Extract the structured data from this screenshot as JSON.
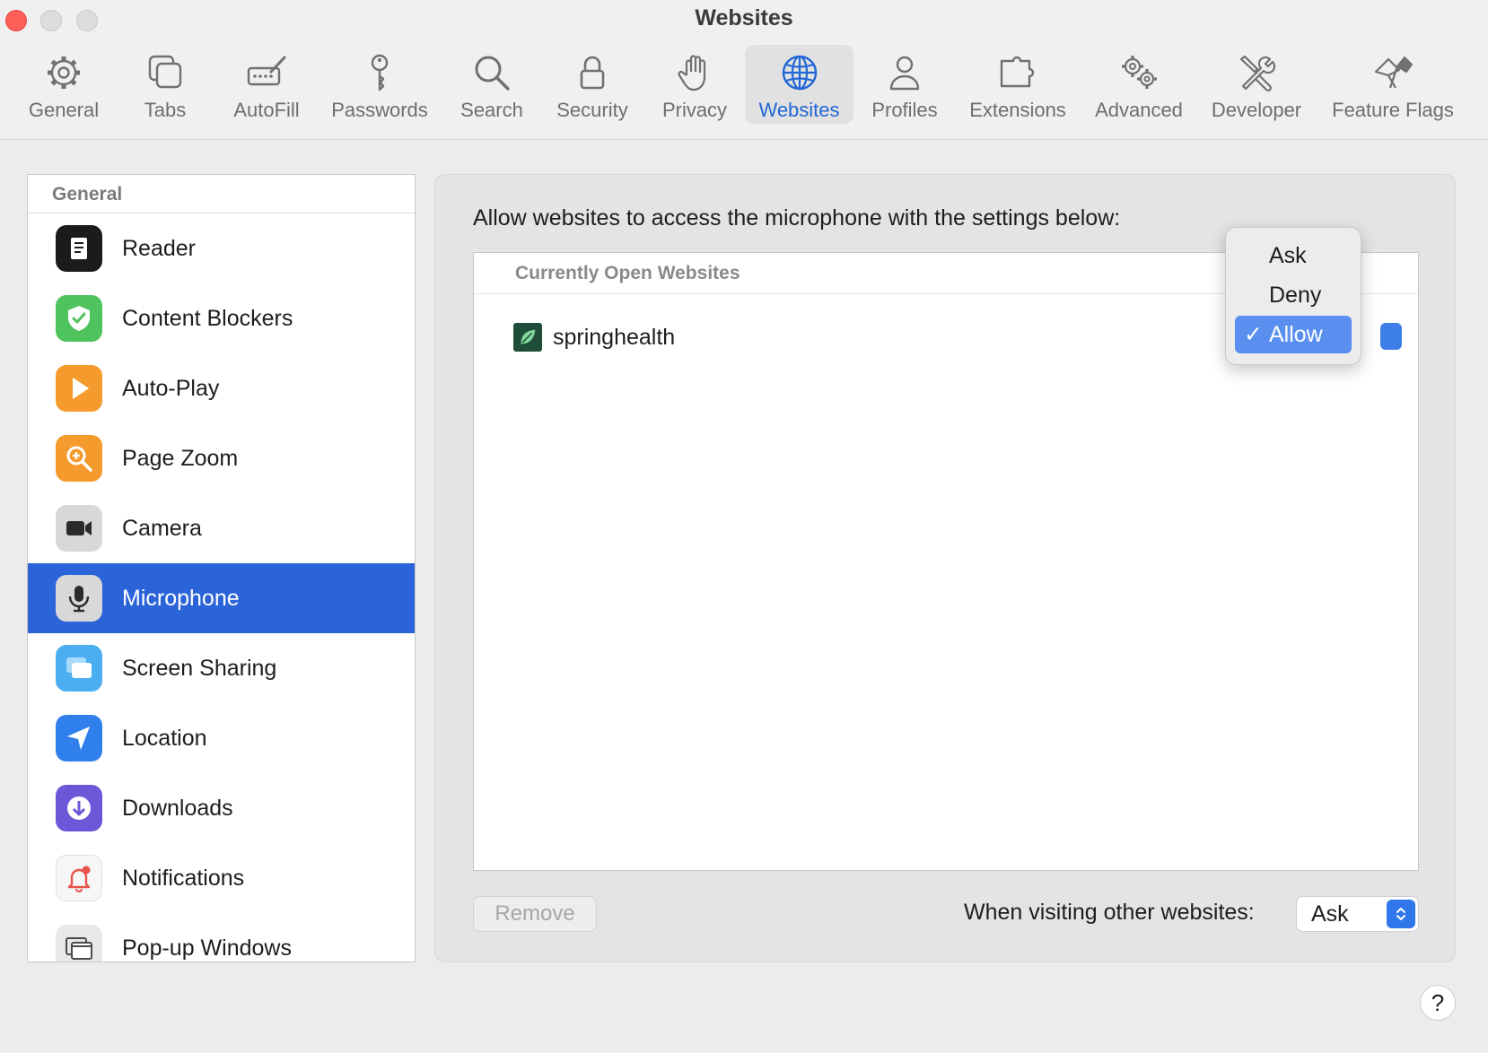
{
  "window": {
    "title": "Websites"
  },
  "toolbar": {
    "items": [
      {
        "label": "General",
        "icon": "gear-icon"
      },
      {
        "label": "Tabs",
        "icon": "tabs-icon"
      },
      {
        "label": "AutoFill",
        "icon": "autofill-icon"
      },
      {
        "label": "Passwords",
        "icon": "key-icon"
      },
      {
        "label": "Search",
        "icon": "search-icon"
      },
      {
        "label": "Security",
        "icon": "lock-icon"
      },
      {
        "label": "Privacy",
        "icon": "hand-icon"
      },
      {
        "label": "Websites",
        "icon": "globe-icon",
        "selected": true
      },
      {
        "label": "Profiles",
        "icon": "person-icon"
      },
      {
        "label": "Extensions",
        "icon": "puzzle-icon"
      },
      {
        "label": "Advanced",
        "icon": "gears-icon"
      },
      {
        "label": "Developer",
        "icon": "tools-icon"
      },
      {
        "label": "Feature Flags",
        "icon": "flags-icon"
      }
    ]
  },
  "sidebar": {
    "header": "General",
    "items": [
      {
        "label": "Reader",
        "icon": "reader-icon"
      },
      {
        "label": "Content Blockers",
        "icon": "shield-check-icon"
      },
      {
        "label": "Auto-Play",
        "icon": "play-icon"
      },
      {
        "label": "Page Zoom",
        "icon": "zoom-icon"
      },
      {
        "label": "Camera",
        "icon": "camera-icon"
      },
      {
        "label": "Microphone",
        "icon": "microphone-icon",
        "selected": true
      },
      {
        "label": "Screen Sharing",
        "icon": "screen-sharing-icon"
      },
      {
        "label": "Location",
        "icon": "location-arrow-icon"
      },
      {
        "label": "Downloads",
        "icon": "download-icon"
      },
      {
        "label": "Notifications",
        "icon": "bell-icon"
      },
      {
        "label": "Pop-up Windows",
        "icon": "popup-window-icon"
      }
    ]
  },
  "content": {
    "description": "Allow websites to access the microphone with the settings below:",
    "list_header": "Currently Open Websites",
    "sites": [
      {
        "name": "springhealth",
        "setting": "Allow"
      }
    ],
    "remove_label": "Remove",
    "other_label": "When visiting other websites:",
    "other_value": "Ask"
  },
  "popup_menu": {
    "options": [
      "Ask",
      "Deny",
      "Allow"
    ],
    "selected": "Allow",
    "check_glyph": "✓"
  },
  "help": {
    "label": "?"
  },
  "colors": {
    "accent": "#2b63d9",
    "toolbar_selected_text": "#2266d6",
    "popup_highlight": "#5a8ff0"
  }
}
